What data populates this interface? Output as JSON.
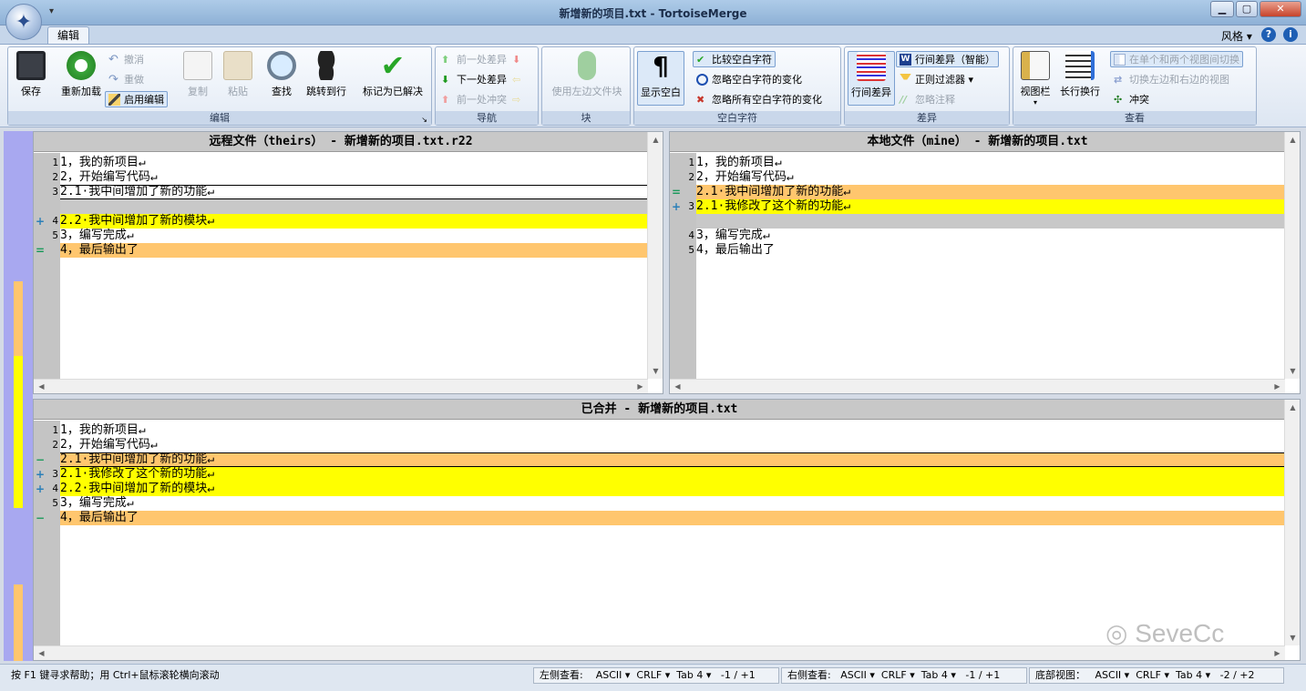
{
  "window": {
    "title": "新增新的项目.txt - TortoiseMerge",
    "min": "▁",
    "max": "▢",
    "close": "✕"
  },
  "ribbon": {
    "tab": "编辑",
    "style": "风格",
    "help_icon": "?",
    "info_icon": "i",
    "groups": {
      "edit": {
        "label": "编辑",
        "save": "保存",
        "reload": "重新加载",
        "undo": "撤消",
        "redo": "重做",
        "enable_edit": "启用编辑",
        "copy": "复制",
        "paste": "粘贴",
        "find": "查找",
        "goto": "跳转到行",
        "mark_resolved": "标记为已解决"
      },
      "nav": {
        "label": "导航",
        "prev_diff": "前一处差异",
        "next_diff": "下一处差异",
        "prev_conflict": "前一处冲突"
      },
      "block": {
        "label": "块",
        "use_left": "使用左边文件块"
      },
      "whitespace": {
        "label": "空白字符",
        "show_ws": "显示空白",
        "compare_ws": "比较空白字符",
        "ignore_ws_change": "忽略空白字符的变化",
        "ignore_all_ws": "忽略所有空白字符的变化"
      },
      "diff": {
        "label": "差异",
        "inline_diff": "行间差异",
        "inline_smart": "行间差异（智能）",
        "regex_filter": "正则过滤器",
        "ignore_comments": "忽略注释"
      },
      "view": {
        "label": "查看",
        "view_bar": "视图栏",
        "wrap": "长行换行",
        "switch_one_two": "在单个和两个视图间切换",
        "swap_left_right": "切换左边和右边的视图",
        "conflict": "冲突"
      }
    }
  },
  "panes": {
    "left": {
      "header": "远程文件（theirs） - 新增新的项目.txt.r22",
      "lines": [
        {
          "no": "1",
          "text": "1，我的新项目↵",
          "bg": "#ffffff",
          "mark": ""
        },
        {
          "no": "2",
          "text": "2，开始编写代码↵",
          "bg": "#ffffff",
          "mark": ""
        },
        {
          "no": "3",
          "text": "2.1·我中间增加了新的功能↵",
          "bg": "#ffffff",
          "mark": "",
          "boxed": true
        },
        {
          "no": "",
          "text": "",
          "bg": "#c8c8c8",
          "mark": ""
        },
        {
          "no": "4",
          "text": "2.2·我中间增加了新的模块↵",
          "bg": "#ffff00",
          "mark": "+"
        },
        {
          "no": "5",
          "text": "3，编写完成↵",
          "bg": "#ffffff",
          "mark": ""
        },
        {
          "no": "",
          "text": "4，最后输出了",
          "bg": "#ffc66e",
          "mark": "="
        }
      ]
    },
    "right": {
      "header": "本地文件（mine） - 新增新的项目.txt",
      "lines": [
        {
          "no": "1",
          "text": "1，我的新项目↵",
          "bg": "#ffffff",
          "mark": ""
        },
        {
          "no": "2",
          "text": "2，开始编写代码↵",
          "bg": "#ffffff",
          "mark": ""
        },
        {
          "no": "",
          "text": "2.1·我中间增加了新的功能↵",
          "bg": "#ffc66e",
          "mark": "="
        },
        {
          "no": "3",
          "text": "2.1·我修改了这个新的功能↵",
          "bg": "#ffff00",
          "mark": "+"
        },
        {
          "no": "",
          "text": "",
          "bg": "#c8c8c8",
          "mark": ""
        },
        {
          "no": "4",
          "text": "3，编写完成↵",
          "bg": "#ffffff",
          "mark": ""
        },
        {
          "no": "5",
          "text": "4，最后输出了",
          "bg": "#ffffff",
          "mark": ""
        }
      ]
    },
    "bottom": {
      "header": "已合并 - 新增新的项目.txt",
      "lines": [
        {
          "no": "1",
          "text": "1，我的新项目↵",
          "bg": "#ffffff",
          "mark": ""
        },
        {
          "no": "2",
          "text": "2，开始编写代码↵",
          "bg": "#ffffff",
          "mark": ""
        },
        {
          "no": "",
          "text": "2.1·我中间增加了新的功能↵",
          "bg": "#ffc66e",
          "mark": "−",
          "boxed": true
        },
        {
          "no": "3",
          "text": "2.1·我修改了这个新的功能↵",
          "bg": "#ffff00",
          "mark": "+"
        },
        {
          "no": "4",
          "text": "2.2·我中间增加了新的模块↵",
          "bg": "#ffff00",
          "mark": "+"
        },
        {
          "no": "5",
          "text": "3，编写完成↵",
          "bg": "#ffffff",
          "mark": ""
        },
        {
          "no": "",
          "text": "4，最后输出了",
          "bg": "#ffc66e",
          "mark": "−"
        }
      ]
    }
  },
  "watermark": "SeveCc",
  "status": {
    "help": "按 F1 键寻求帮助；用 Ctrl+鼠标滚轮横向滚动",
    "left": {
      "label": "左侧查看:",
      "enc": "ASCII",
      "eol": "CRLF",
      "tab": "Tab 4",
      "diff": "-1 / +1"
    },
    "right": {
      "label": "右侧查看:",
      "enc": "ASCII",
      "eol": "CRLF",
      "tab": "Tab 4",
      "diff": "-1 / +1"
    },
    "bottom": {
      "label": "底部视图：",
      "enc": "ASCII",
      "eol": "CRLF",
      "tab": "Tab 4",
      "diff": "-2 / +2"
    }
  },
  "colors": {
    "added": "#ffff00",
    "conflict": "#ffc66e",
    "filler": "#c8c8c8",
    "strip_blue": "#a8a8f0",
    "strip_orange": "#ffc66e",
    "strip_yellow": "#ffff00"
  }
}
